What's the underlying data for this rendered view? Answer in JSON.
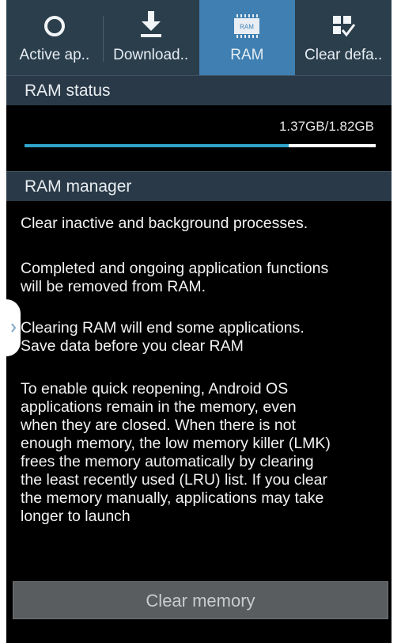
{
  "tabs": [
    {
      "label": "Active ap..",
      "icon": "circle-icon",
      "active": false
    },
    {
      "label": "Download..",
      "icon": "download-icon",
      "active": false
    },
    {
      "label": "RAM",
      "icon": "ram-chip-icon",
      "active": true,
      "chip_text": "RAM"
    },
    {
      "label": "Clear defa..",
      "icon": "clear-defaults-icon",
      "active": false
    }
  ],
  "ram_status": {
    "header": "RAM status",
    "value": "1.37GB/1.82GB",
    "used_fraction": 0.753
  },
  "ram_manager": {
    "header": "RAM manager",
    "paragraphs": [
      [
        "Clear inactive and background processes."
      ],
      [
        "Completed and ongoing application functions",
        "will be removed from RAM."
      ],
      [
        "Clearing RAM will end some applications.",
        "Save data before you clear RAM"
      ],
      [
        "To enable quick reopening, Android OS",
        "applications remain in the memory, even",
        "when they are closed. When there is not",
        "enough memory, the low memory killer (LMK)",
        "frees the memory automatically by clearing",
        "the least recently used (LRU) list. If you clear",
        "the memory manually, applications may take",
        "longer to launch"
      ]
    ],
    "button_label": "Clear memory"
  },
  "colors": {
    "tabbar": "#2b3e4c",
    "active_tab": "#3f7fb1",
    "progress_fill": "#2fa5c9",
    "button": "#5a5d60"
  }
}
